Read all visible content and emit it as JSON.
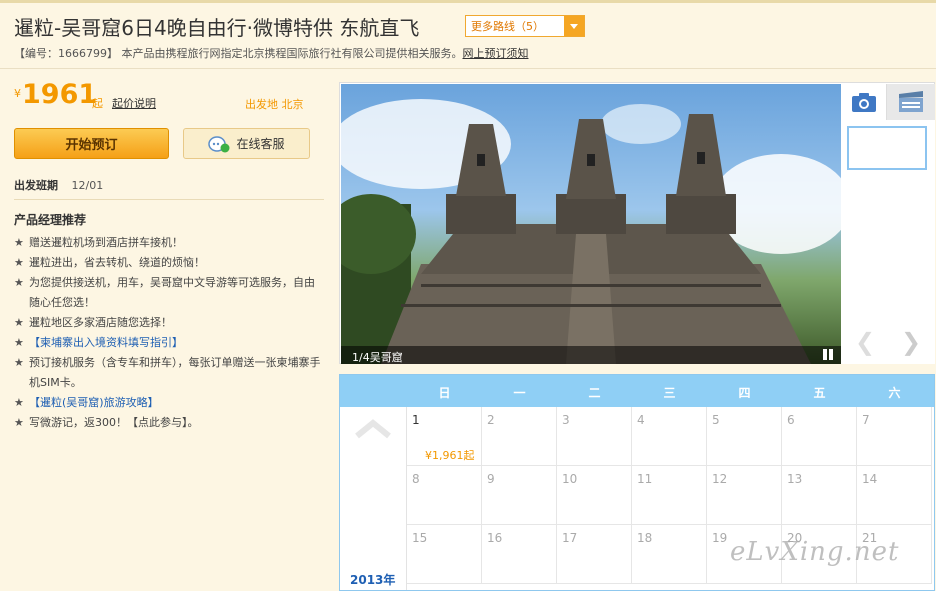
{
  "header": {
    "title": "暹粒-吴哥窟6日4晚自由行·微博特供 东航直飞",
    "more_routes_label": "更多路线（5）",
    "product_code_text": "【编号：1666799】 本产品由携程旅行网指定北京携程国际旅行社有限公司提供相关服务。",
    "booking_notice_link": "网上预订须知"
  },
  "pricing": {
    "currency": "¥",
    "amount": "1961",
    "from_suffix": "起",
    "explain_link": "起价说明",
    "depart_city_label": "出发地",
    "depart_city": "北京"
  },
  "actions": {
    "book_label": "开始预订",
    "service_label": "在线客服"
  },
  "departure": {
    "label": "出发班期",
    "value": "12/01"
  },
  "recommend": {
    "title": "产品经理推荐",
    "star": "★",
    "items": [
      {
        "text": "赠送暹粒机场到酒店拼车接机！",
        "link": false
      },
      {
        "text": "暹粒进出，省去转机、绕道的烦恼！",
        "link": false
      },
      {
        "text": "为您提供接送机，用车，吴哥窟中文导游等可选服务，自由随心任您选！",
        "link": false
      },
      {
        "text": "暹粒地区多家酒店随您选择！",
        "link": false
      },
      {
        "text": "【柬埔寨出入境资料填写指引】",
        "link": true
      },
      {
        "text": "预订接机服务（含专车和拼车），每张订单赠送一张柬埔寨手机SIM卡。",
        "link": false
      },
      {
        "text": "【暹粒(吴哥窟)旅游攻略】",
        "link": true
      },
      {
        "text": "写微游记，返300！【点此参与】。",
        "link": false
      }
    ]
  },
  "gallery": {
    "caption": "1/4吴哥窟",
    "prev_glyph": "❮",
    "next_glyph": "❯"
  },
  "calendar": {
    "weekdays": [
      "日",
      "一",
      "二",
      "三",
      "四",
      "五",
      "六"
    ],
    "year_label": "2013年",
    "rows": [
      [
        {
          "day": "1",
          "price": "¥1,961起",
          "active": true
        },
        {
          "day": "2"
        },
        {
          "day": "3"
        },
        {
          "day": "4"
        },
        {
          "day": "5"
        },
        {
          "day": "6"
        },
        {
          "day": "7"
        }
      ],
      [
        {
          "day": "8"
        },
        {
          "day": "9"
        },
        {
          "day": "10"
        },
        {
          "day": "11"
        },
        {
          "day": "12"
        },
        {
          "day": "13"
        },
        {
          "day": "14"
        }
      ],
      [
        {
          "day": "15"
        },
        {
          "day": "16"
        },
        {
          "day": "17"
        },
        {
          "day": "18"
        },
        {
          "day": "19"
        },
        {
          "day": "20"
        },
        {
          "day": "21"
        }
      ]
    ]
  },
  "watermark": "eLvXing.net",
  "colors": {
    "accent": "#f39800",
    "link": "#1e5fb3",
    "calendar_header": "#8fcff5",
    "page_bg": "#fdf6e3"
  }
}
